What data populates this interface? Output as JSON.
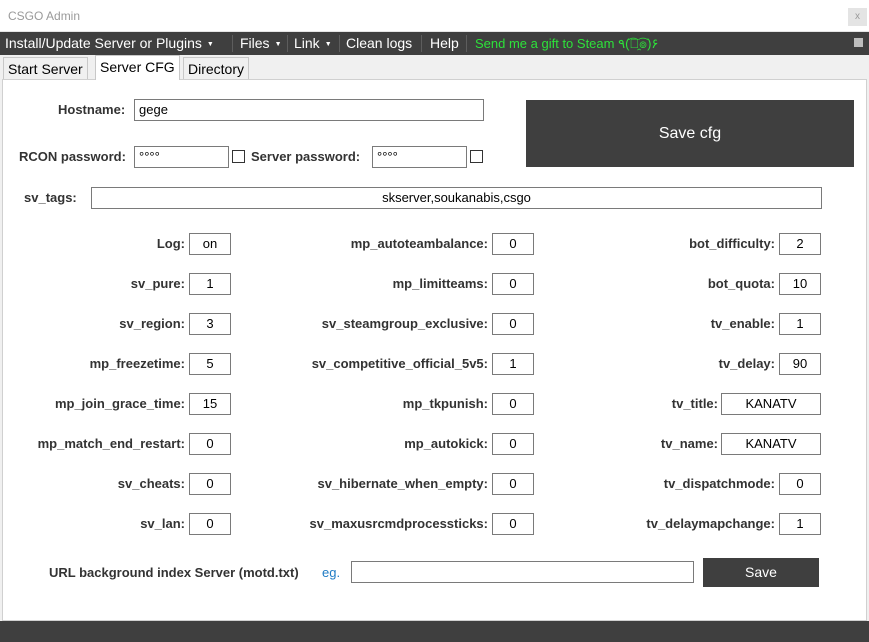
{
  "window": {
    "title": "CSGO Admin",
    "close_glyph": "x"
  },
  "menu": {
    "items": [
      {
        "label": "Install/Update Server or Plugins",
        "has_dropdown": true
      },
      {
        "label": "Files",
        "has_dropdown": true
      },
      {
        "label": "Link",
        "has_dropdown": true
      },
      {
        "label": "Clean logs",
        "has_dropdown": false
      },
      {
        "label": "Help",
        "has_dropdown": false
      }
    ],
    "gift": "Send me a gift to Steam ٩(͡๏̯͡๏)۶",
    "caret_glyph": "▼"
  },
  "tabs": [
    {
      "label": "Start Server",
      "active": false
    },
    {
      "label": "Server CFG",
      "active": true
    },
    {
      "label": "Directory",
      "active": false
    }
  ],
  "cfg": {
    "hostname_label": "Hostname:",
    "hostname": "gege",
    "rcon_label": "RCON password:",
    "rcon_password": "°°°°",
    "server_password_label": "Server password:",
    "server_password": "°°°°",
    "save_cfg": "Save cfg",
    "sv_tags_label": "sv_tags:",
    "sv_tags": "skserver,soukanabis,csgo",
    "col1": [
      {
        "label": "Log:",
        "value": "on"
      },
      {
        "label": "sv_pure:",
        "value": "1"
      },
      {
        "label": "sv_region:",
        "value": "3"
      },
      {
        "label": "mp_freezetime:",
        "value": "5"
      },
      {
        "label": "mp_join_grace_time:",
        "value": "15"
      },
      {
        "label": "mp_match_end_restart:",
        "value": "0"
      },
      {
        "label": "sv_cheats:",
        "value": "0"
      },
      {
        "label": "sv_lan:",
        "value": "0"
      }
    ],
    "col2": [
      {
        "label": "mp_autoteambalance:",
        "value": "0"
      },
      {
        "label": "mp_limitteams:",
        "value": "0"
      },
      {
        "label": "sv_steamgroup_exclusive:",
        "value": "0"
      },
      {
        "label": "sv_competitive_official_5v5:",
        "value": "1"
      },
      {
        "label": "mp_tkpunish:",
        "value": "0"
      },
      {
        "label": "mp_autokick:",
        "value": "0"
      },
      {
        "label": "sv_hibernate_when_empty:",
        "value": "0"
      },
      {
        "label": "sv_maxusrcmdprocessticks:",
        "value": "0"
      }
    ],
    "col3": [
      {
        "label": "bot_difficulty:",
        "value": "2"
      },
      {
        "label": "bot_quota:",
        "value": "10"
      },
      {
        "label": "tv_enable:",
        "value": "1"
      },
      {
        "label": "tv_delay:",
        "value": "90"
      },
      {
        "label": "tv_title:",
        "value": "KANATV"
      },
      {
        "label": "tv_name:",
        "value": "KANATV"
      },
      {
        "label": "tv_dispatchmode:",
        "value": "0"
      },
      {
        "label": "tv_delaymapchange:",
        "value": "1"
      }
    ],
    "url_label": "URL background index Server (motd.txt)",
    "url_eg": "eg.",
    "url_value": "",
    "save": "Save"
  }
}
